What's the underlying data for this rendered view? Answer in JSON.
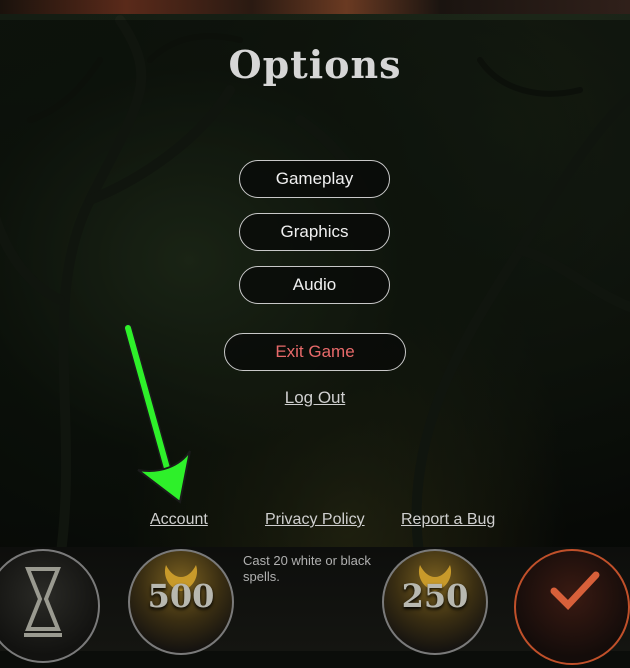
{
  "options": {
    "title": "Options",
    "buttons": {
      "gameplay": "Gameplay",
      "graphics": "Graphics",
      "audio": "Audio",
      "exit": "Exit Game"
    },
    "logout": "Log Out",
    "footer_links": {
      "account": "Account",
      "privacy": "Privacy Policy",
      "report_bug": "Report a Bug"
    }
  },
  "hud": {
    "quest_text": "Cast 20 white or black spells.",
    "reward_left": "500",
    "reward_right": "250"
  },
  "colors": {
    "exit_text": "#e86a6a",
    "annotation_arrow": "#2ef02a"
  },
  "icons": [
    "hourglass-icon",
    "checkmark-icon",
    "coin-icon"
  ]
}
